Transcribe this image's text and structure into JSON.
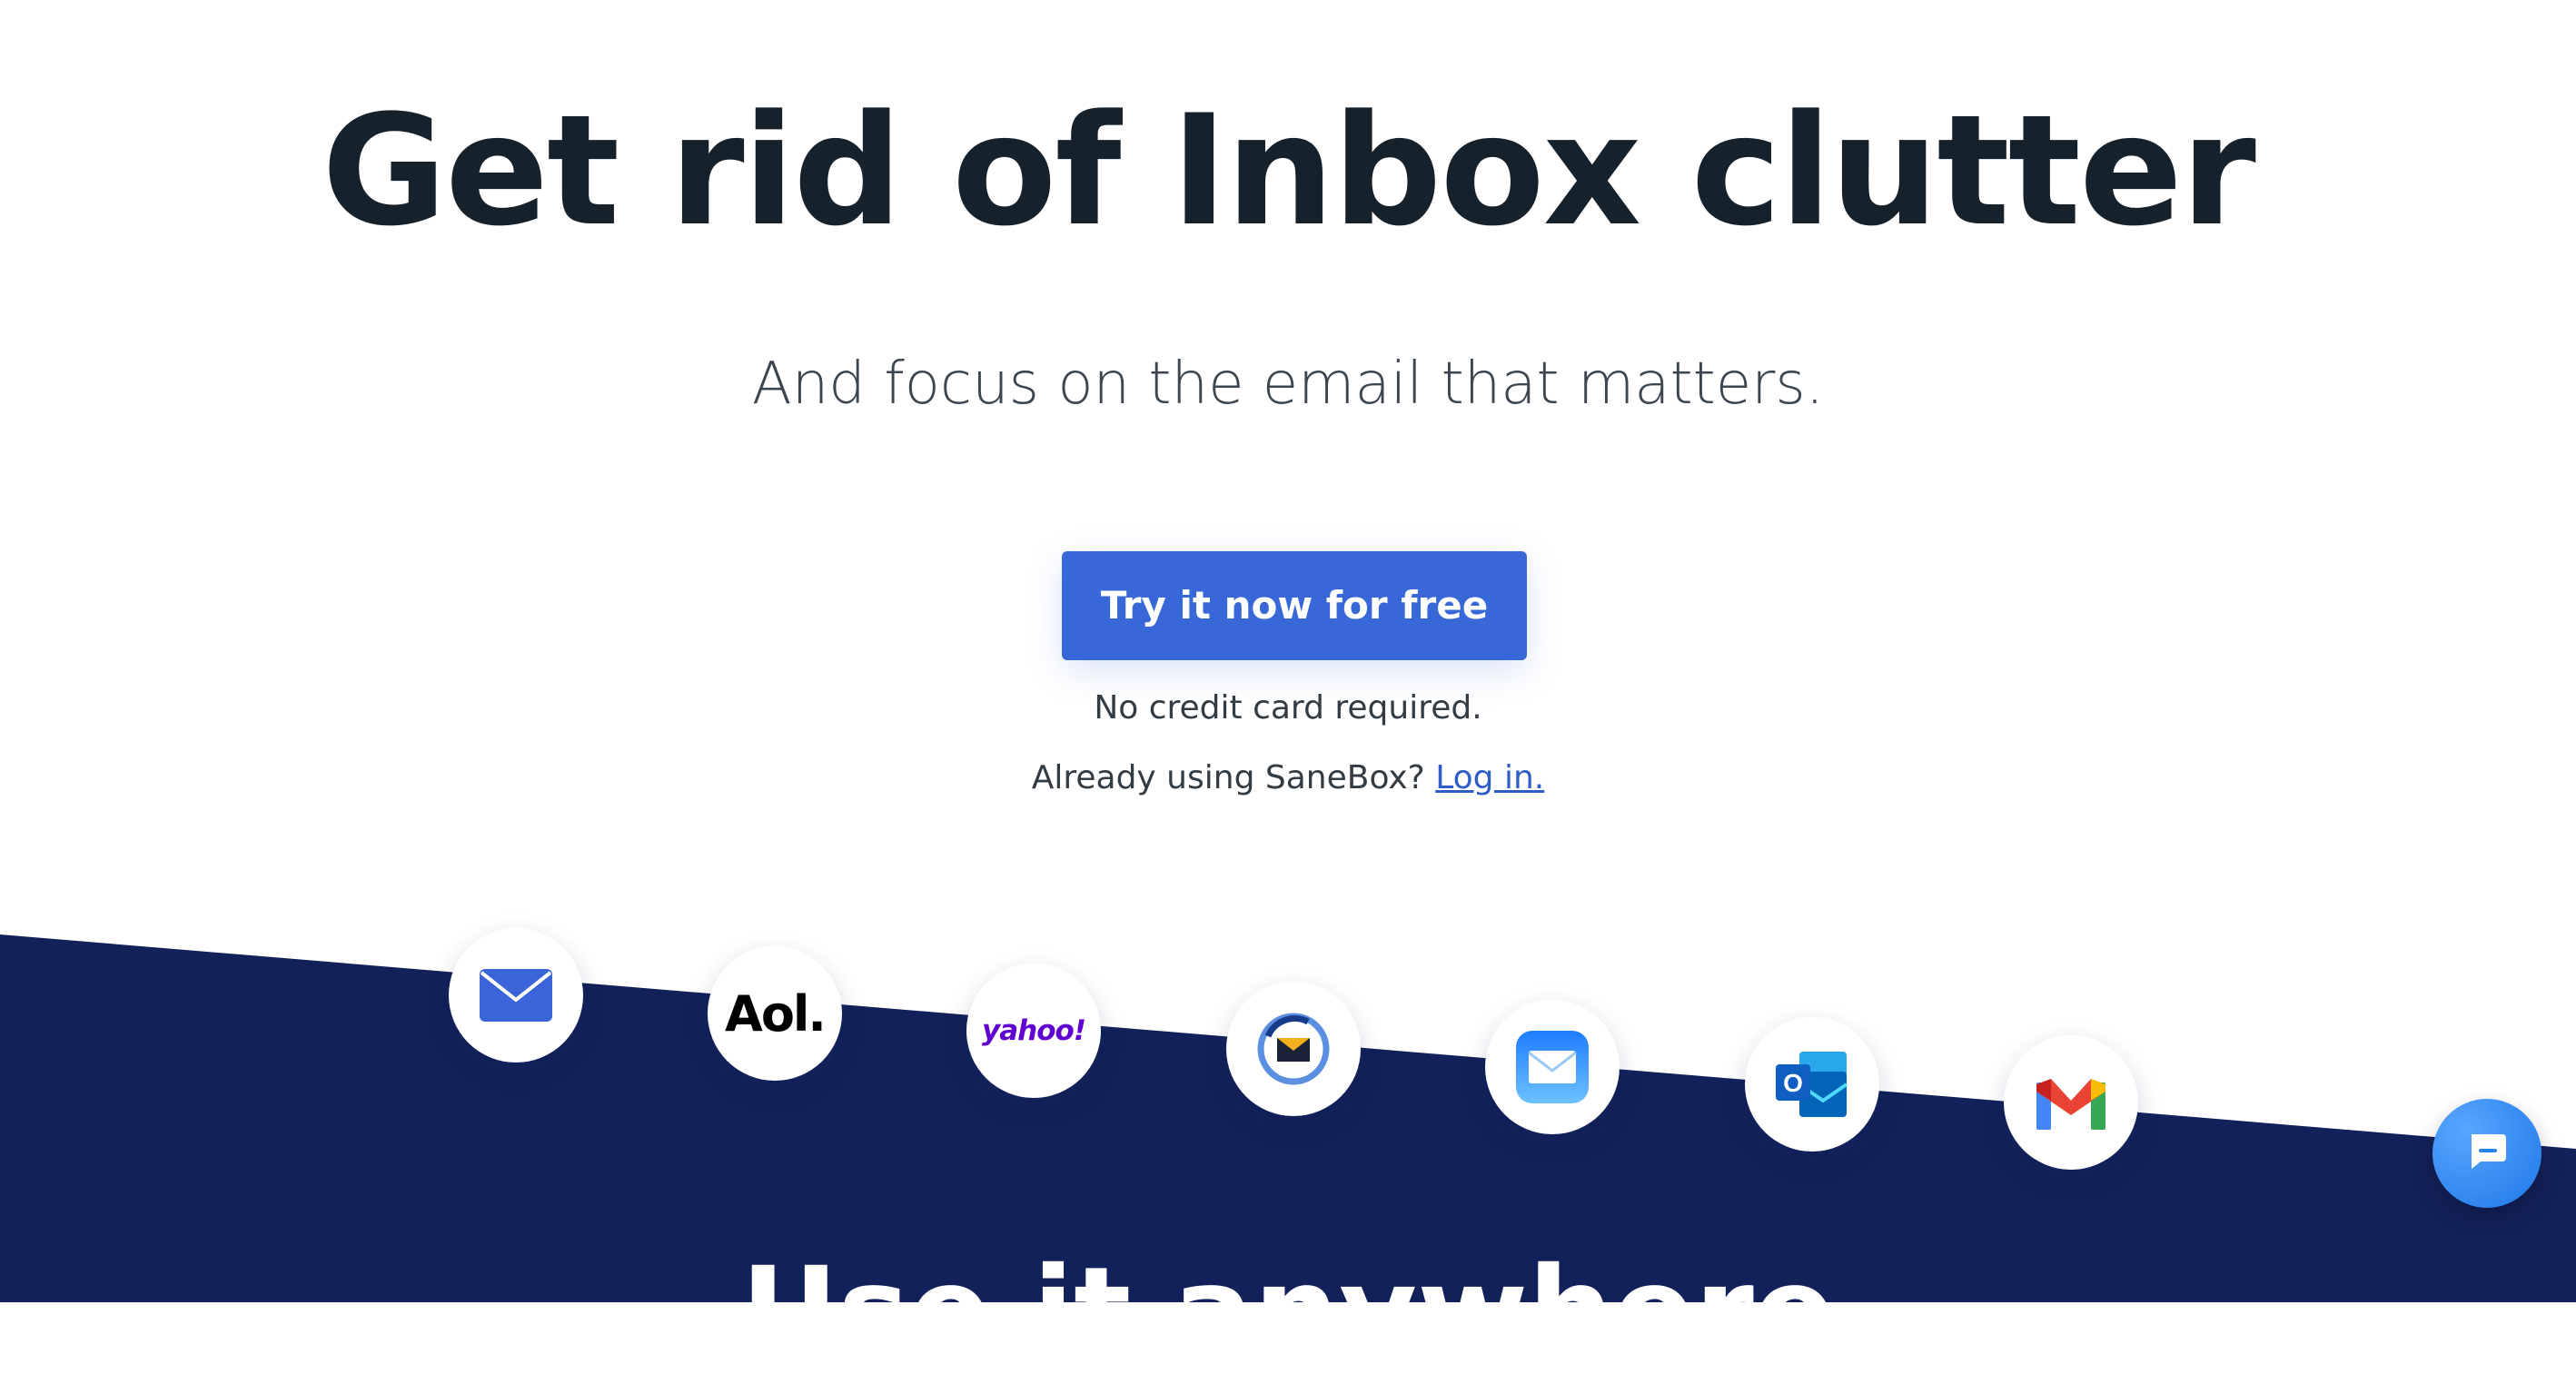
{
  "hero": {
    "headline": "Get rid of Inbox clutter",
    "subheadline": "And focus on the email that matters.",
    "cta_label": "Try it now for free",
    "no_card_note": "No credit card required.",
    "login_prompt": "Already using SaneBox?",
    "login_link": "Log in."
  },
  "providers": [
    {
      "name": "generic-mail",
      "icon": "envelope-icon"
    },
    {
      "name": "aol",
      "icon": "aol-logo",
      "label": "Aol."
    },
    {
      "name": "yahoo",
      "icon": "yahoo-logo",
      "label": "yahoo!"
    },
    {
      "name": "postbox",
      "icon": "postbox-icon"
    },
    {
      "name": "apple-mail",
      "icon": "apple-mail-icon"
    },
    {
      "name": "outlook",
      "icon": "outlook-icon",
      "label": "O"
    },
    {
      "name": "gmail",
      "icon": "gmail-icon"
    }
  ],
  "section": {
    "title": "Use it anywhere"
  },
  "chat": {
    "icon": "chat-bubble-icon"
  },
  "colors": {
    "navy": "#13215a",
    "accent": "#3868d8",
    "headline": "#15212b",
    "link": "#2f5dc8",
    "yahoo": "#6001d2"
  }
}
